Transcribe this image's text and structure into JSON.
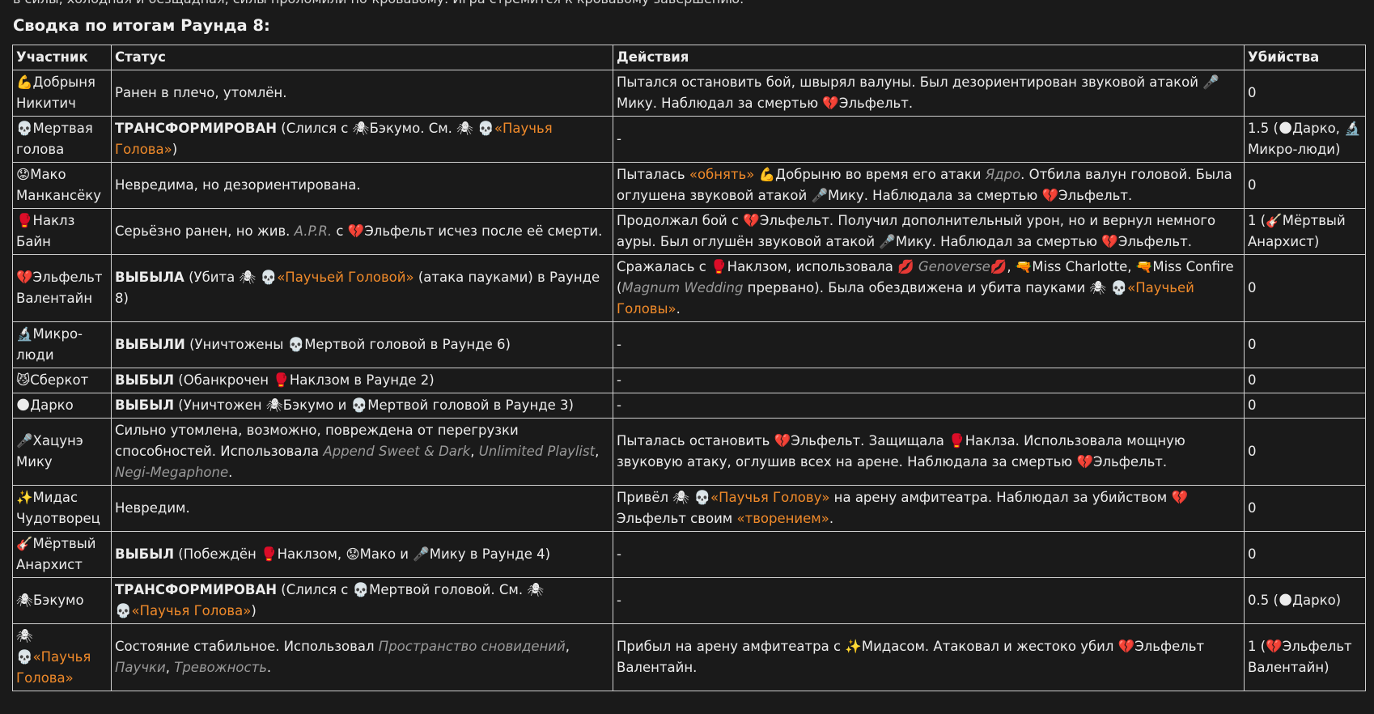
{
  "top_line": "в силы, холодная и безщадная, силы проломили по-кровавому. Игра стремится к кровавому завершению.",
  "heading": "Сводка по итогам Раунда 8:",
  "headers": [
    "Участник",
    "Статус",
    "Действия",
    "Убийства"
  ],
  "rows": [
    {
      "name": [
        {
          "t": "💪"
        },
        {
          "t": "Добрыня Никитич"
        }
      ],
      "status": [
        {
          "t": "Ранен в плечо, утомлён."
        }
      ],
      "actions": [
        {
          "t": "Пытался остановить бой, швырял валуны. Был дезориентирован звуковой атакой "
        },
        {
          "t": "🎤"
        },
        {
          "t": "Мику. Наблюдал за смертью "
        },
        {
          "t": "💔"
        },
        {
          "t": "Эльфельт."
        }
      ],
      "kills": [
        {
          "t": "0"
        }
      ]
    },
    {
      "name": [
        {
          "t": "💀"
        },
        {
          "t": "Мертвая голова"
        }
      ],
      "status": [
        {
          "t": "ТРАНСФОРМИРОВАН",
          "s": "b"
        },
        {
          "t": " (Слился с "
        },
        {
          "t": "🕷"
        },
        {
          "t": "Бэкумо. См. "
        },
        {
          "t": "🕷 💀"
        },
        {
          "t": "«Паучья Голова»",
          "s": "link"
        },
        {
          "t": ")"
        }
      ],
      "actions": [
        {
          "t": "-"
        }
      ],
      "kills": [
        {
          "t": "1.5 ("
        },
        {
          "t": "🌑"
        },
        {
          "t": "Дарко, "
        },
        {
          "t": "🔬"
        },
        {
          "t": "Микро-люди)"
        }
      ]
    },
    {
      "name": [
        {
          "t": "😟"
        },
        {
          "t": "Мако Манкансёку"
        }
      ],
      "status": [
        {
          "t": "Невредима, но дезориентирована."
        }
      ],
      "actions": [
        {
          "t": "Пыталась "
        },
        {
          "t": "«обнять»",
          "s": "link"
        },
        {
          "t": " "
        },
        {
          "t": "💪"
        },
        {
          "t": "Добрыню во время его атаки "
        },
        {
          "t": "Ядро",
          "s": "it"
        },
        {
          "t": ". Отбила валун головой. Была оглушена звуковой атакой "
        },
        {
          "t": "🎤"
        },
        {
          "t": "Мику. Наблюдала за смертью "
        },
        {
          "t": "💔"
        },
        {
          "t": "Эльфельт."
        }
      ],
      "kills": [
        {
          "t": "0"
        }
      ]
    },
    {
      "name": [
        {
          "t": "🥊"
        },
        {
          "t": "Наклз Байн"
        }
      ],
      "status": [
        {
          "t": "Серьёзно ранен, но жив. "
        },
        {
          "t": "A.P.R.",
          "s": "it"
        },
        {
          "t": " с "
        },
        {
          "t": "💔"
        },
        {
          "t": "Эльфельт исчез после её смерти."
        }
      ],
      "actions": [
        {
          "t": "Продолжал бой с "
        },
        {
          "t": "💔"
        },
        {
          "t": "Эльфельт. Получил дополнительный урон, но и вернул немного ауры. Был оглушён звуковой атакой "
        },
        {
          "t": "🎤"
        },
        {
          "t": "Мику. Наблюдал за смертью "
        },
        {
          "t": "💔"
        },
        {
          "t": "Эльфельт."
        }
      ],
      "kills": [
        {
          "t": "1 ("
        },
        {
          "t": "🎸"
        },
        {
          "t": "Мёртвый Анархист)"
        }
      ]
    },
    {
      "name": [
        {
          "t": "💔"
        },
        {
          "t": "Эльфельт Валентайн"
        }
      ],
      "status": [
        {
          "t": "ВЫБЫЛА",
          "s": "b"
        },
        {
          "t": " (Убита "
        },
        {
          "t": "🕷 💀"
        },
        {
          "t": "«Паучьей Головой»",
          "s": "link"
        },
        {
          "t": " (атака пауками) в Раунде 8)"
        }
      ],
      "actions": [
        {
          "t": "Сражалась с "
        },
        {
          "t": "🥊"
        },
        {
          "t": "Наклзом, использовала "
        },
        {
          "t": "💋"
        },
        {
          "t": " "
        },
        {
          "t": "Genoverse",
          "s": "it"
        },
        {
          "t": "💋"
        },
        {
          "t": ", "
        },
        {
          "t": "🔫"
        },
        {
          "t": "Miss Charlotte, "
        },
        {
          "t": "🔫"
        },
        {
          "t": "Miss Confire ("
        },
        {
          "t": "Magnum Wedding",
          "s": "it"
        },
        {
          "t": " прервано). Была обездвижена и убита пауками "
        },
        {
          "t": "🕷 💀"
        },
        {
          "t": "«Паучьей Головы»",
          "s": "link"
        },
        {
          "t": "."
        }
      ],
      "kills": [
        {
          "t": "0"
        }
      ]
    },
    {
      "name": [
        {
          "t": "🔬"
        },
        {
          "t": "Микро-люди"
        }
      ],
      "status": [
        {
          "t": "ВЫБЫЛИ",
          "s": "b"
        },
        {
          "t": " (Уничтожены "
        },
        {
          "t": "💀"
        },
        {
          "t": "Мертвой головой в Раунде 6)"
        }
      ],
      "actions": [
        {
          "t": "-"
        }
      ],
      "kills": [
        {
          "t": "0"
        }
      ]
    },
    {
      "name": [
        {
          "t": "😼"
        },
        {
          "t": "Сберкот"
        }
      ],
      "status": [
        {
          "t": "ВЫБЫЛ",
          "s": "b"
        },
        {
          "t": " (Обанкрочен "
        },
        {
          "t": "🥊"
        },
        {
          "t": "Наклзом в Раунде 2)"
        }
      ],
      "actions": [
        {
          "t": "-"
        }
      ],
      "kills": [
        {
          "t": "0"
        }
      ]
    },
    {
      "name": [
        {
          "t": "🌑"
        },
        {
          "t": "Дарко"
        }
      ],
      "status": [
        {
          "t": "ВЫБЫЛ",
          "s": "b"
        },
        {
          "t": " (Уничтожен "
        },
        {
          "t": "🕷"
        },
        {
          "t": "Бэкумо и "
        },
        {
          "t": "💀"
        },
        {
          "t": "Мертвой головой в Раунде 3)"
        }
      ],
      "actions": [
        {
          "t": "-"
        }
      ],
      "kills": [
        {
          "t": "0"
        }
      ]
    },
    {
      "name": [
        {
          "t": "🎤"
        },
        {
          "t": "Хацунэ Мику"
        }
      ],
      "status": [
        {
          "t": "Сильно утомлена, возможно, повреждена от перегрузки способностей. Использовала "
        },
        {
          "t": "Append Sweet & Dark",
          "s": "it"
        },
        {
          "t": ", "
        },
        {
          "t": "Unlimited Playlist",
          "s": "it"
        },
        {
          "t": ", "
        },
        {
          "t": "Negi-Megaphone",
          "s": "it"
        },
        {
          "t": "."
        }
      ],
      "actions": [
        {
          "t": "Пыталась остановить "
        },
        {
          "t": "💔"
        },
        {
          "t": "Эльфельт. Защищала "
        },
        {
          "t": "🥊"
        },
        {
          "t": "Наклза. Использовала мощную звуковую атаку, оглушив всех на арене. Наблюдала за смертью "
        },
        {
          "t": "💔"
        },
        {
          "t": "Эльфельт."
        }
      ],
      "kills": [
        {
          "t": "0"
        }
      ]
    },
    {
      "name": [
        {
          "t": "✨"
        },
        {
          "t": "Мидас Чудотворец"
        }
      ],
      "status": [
        {
          "t": "Невредим."
        }
      ],
      "actions": [
        {
          "t": "Привёл "
        },
        {
          "t": "🕷 💀"
        },
        {
          "t": "«Паучья Голову»",
          "s": "link"
        },
        {
          "t": " на арену амфитеатра. Наблюдал за убийством "
        },
        {
          "t": "💔"
        },
        {
          "t": "Эльфельт своим "
        },
        {
          "t": "«творением»",
          "s": "link"
        },
        {
          "t": "."
        }
      ],
      "kills": [
        {
          "t": "0"
        }
      ]
    },
    {
      "name": [
        {
          "t": "🎸"
        },
        {
          "t": "Мёртвый Анархист"
        }
      ],
      "status": [
        {
          "t": "ВЫБЫЛ",
          "s": "b"
        },
        {
          "t": " (Побеждён "
        },
        {
          "t": "🥊"
        },
        {
          "t": "Наклзом, "
        },
        {
          "t": "😟"
        },
        {
          "t": "Мако и "
        },
        {
          "t": "🎤"
        },
        {
          "t": "Мику в Раунде 4)"
        }
      ],
      "actions": [
        {
          "t": "-"
        }
      ],
      "kills": [
        {
          "t": "0"
        }
      ]
    },
    {
      "name": [
        {
          "t": "🕷"
        },
        {
          "t": "Бэкумо"
        }
      ],
      "status": [
        {
          "t": "ТРАНСФОРМИРОВАН",
          "s": "b"
        },
        {
          "t": " (Слился с "
        },
        {
          "t": "💀"
        },
        {
          "t": "Мертвой головой. См. "
        },
        {
          "t": "🕷 💀"
        },
        {
          "t": "«Паучья Голова»",
          "s": "link"
        },
        {
          "t": ")"
        }
      ],
      "actions": [
        {
          "t": "-"
        }
      ],
      "kills": [
        {
          "t": "0.5 ("
        },
        {
          "t": "🌑"
        },
        {
          "t": "Дарко)"
        }
      ]
    },
    {
      "name": [
        {
          "t": "🕷"
        },
        {
          "t": "💀"
        },
        {
          "t": "«Паучья Голова»",
          "s": "link"
        }
      ],
      "status": [
        {
          "t": "Состояние стабильное. Использовал "
        },
        {
          "t": "Пространство сновидений",
          "s": "it"
        },
        {
          "t": ", "
        },
        {
          "t": "Паучки",
          "s": "it"
        },
        {
          "t": ", "
        },
        {
          "t": "Тревожность",
          "s": "it"
        },
        {
          "t": "."
        }
      ],
      "actions": [
        {
          "t": "Прибыл на арену амфитеатра с "
        },
        {
          "t": "✨"
        },
        {
          "t": "Мидасом. Атаковал и жестоко убил "
        },
        {
          "t": "💔"
        },
        {
          "t": "Эльфельт Валентайн."
        }
      ],
      "kills": [
        {
          "t": "1 ("
        },
        {
          "t": "💔"
        },
        {
          "t": "Эльфельт Валентайн)"
        }
      ]
    }
  ]
}
